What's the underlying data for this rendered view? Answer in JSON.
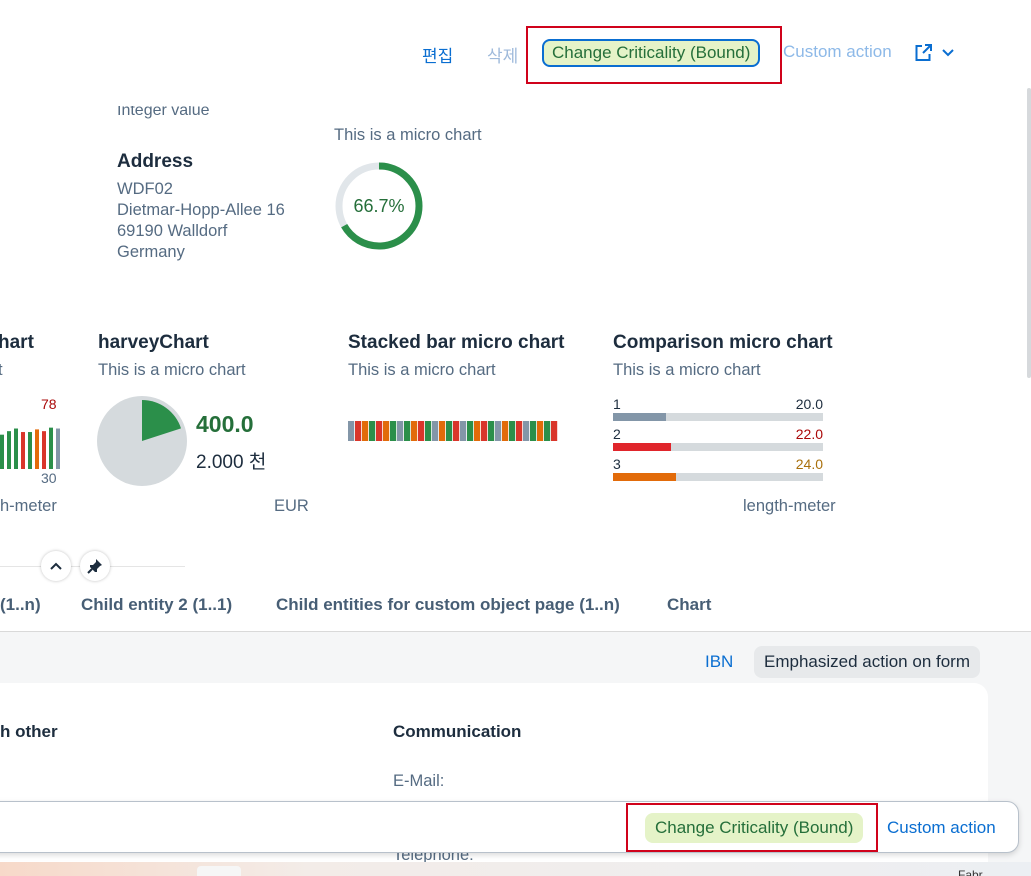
{
  "toolbar": {
    "edit_label": "편집",
    "delete_label": "삭제",
    "change_criticality_label": "Change Criticality (Bound)",
    "custom_action_label": "Custom action",
    "share_icon": "share-icon",
    "dropdown_icon": "chevron-down-icon"
  },
  "header": {
    "truncated_label": "Integer value",
    "address": {
      "title": "Address",
      "lines": [
        "WDF02",
        "Dietmar-Hopp-Allee 16",
        "69190 Walldorf",
        "Germany"
      ]
    },
    "radial_chart": {
      "subtitle": "This is a micro chart",
      "percent": 66.7,
      "label": "66.7%",
      "color": "#2b8f4a"
    }
  },
  "micro_charts": {
    "column_chart": {
      "title_partial": "hart",
      "subtitle_partial": "t",
      "max_label": "78",
      "min_label": "30",
      "unit_partial": "h-meter",
      "bar_colors": [
        "#2b8f4a",
        "#2b8f4a",
        "#2b8f4a",
        "#d9362b",
        "#2b8f4a",
        "#e26b0a",
        "#d9362b",
        "#2b8f4a",
        "#8396a8"
      ],
      "bar_values": [
        0.78,
        0.86,
        0.92,
        0.84,
        0.84,
        0.9,
        0.86,
        0.94,
        0.92
      ]
    },
    "harvey_chart": {
      "title": "harveyChart",
      "subtitle": "This is a micro chart",
      "value_label": "400.0",
      "total_label": "2.000 천",
      "unit": "EUR",
      "fraction": 0.2
    },
    "stacked_bar": {
      "title": "Stacked bar micro chart",
      "subtitle": "This is a micro chart",
      "segment_colors": [
        "#8396a8",
        "#d9362b",
        "#e26b0a",
        "#2b8f4a",
        "#d9362b",
        "#e26b0a",
        "#2b8f4a",
        "#8396a8",
        "#2b8f4a",
        "#e26b0a",
        "#d9362b",
        "#2b8f4a",
        "#8396a8",
        "#e26b0a",
        "#2b8f4a",
        "#d9362b",
        "#8396a8",
        "#2b8f4a",
        "#e26b0a",
        "#d9362b",
        "#2b8f4a",
        "#8396a8",
        "#e26b0a",
        "#2b8f4a",
        "#d9362b",
        "#8396a8",
        "#2b8f4a",
        "#e26b0a",
        "#2b8f4a",
        "#d9362b"
      ]
    },
    "comparison_chart": {
      "title": "Comparison micro chart",
      "subtitle": "This is a micro chart",
      "unit": "length-meter",
      "max_value": 80,
      "rows": [
        {
          "label": "1",
          "value": 20.0,
          "display": "20.0",
          "color": "#8396a8",
          "value_color": "#1d2d3e"
        },
        {
          "label": "2",
          "value": 22.0,
          "display": "22.0",
          "color": "#e0252b",
          "value_color": "#aa0808"
        },
        {
          "label": "3",
          "value": 24.0,
          "display": "24.0",
          "color": "#e26b0a",
          "value_color": "#a9700c"
        }
      ]
    }
  },
  "header_controls": {
    "collapse_icon": "chevron-up-icon",
    "pin_icon": "pin-icon"
  },
  "tabs": [
    {
      "label": "(1..n)"
    },
    {
      "label": "Child entity 2 (1..1)"
    },
    {
      "label": "Child entities for custom object page (1..n)"
    },
    {
      "label": "Chart"
    }
  ],
  "section": {
    "ibn_label": "IBN",
    "emphasized_label": "Emphasized action on form",
    "group_other_partial": "h other",
    "group_communication": "Communication",
    "email_label": "E-Mail:",
    "telephone_label": "Telephone:"
  },
  "footer": {
    "change_criticality_label": "Change Criticality (Bound)",
    "custom_action_label": "Custom action"
  },
  "taskbar": {
    "partial_text": "Fabr"
  }
}
